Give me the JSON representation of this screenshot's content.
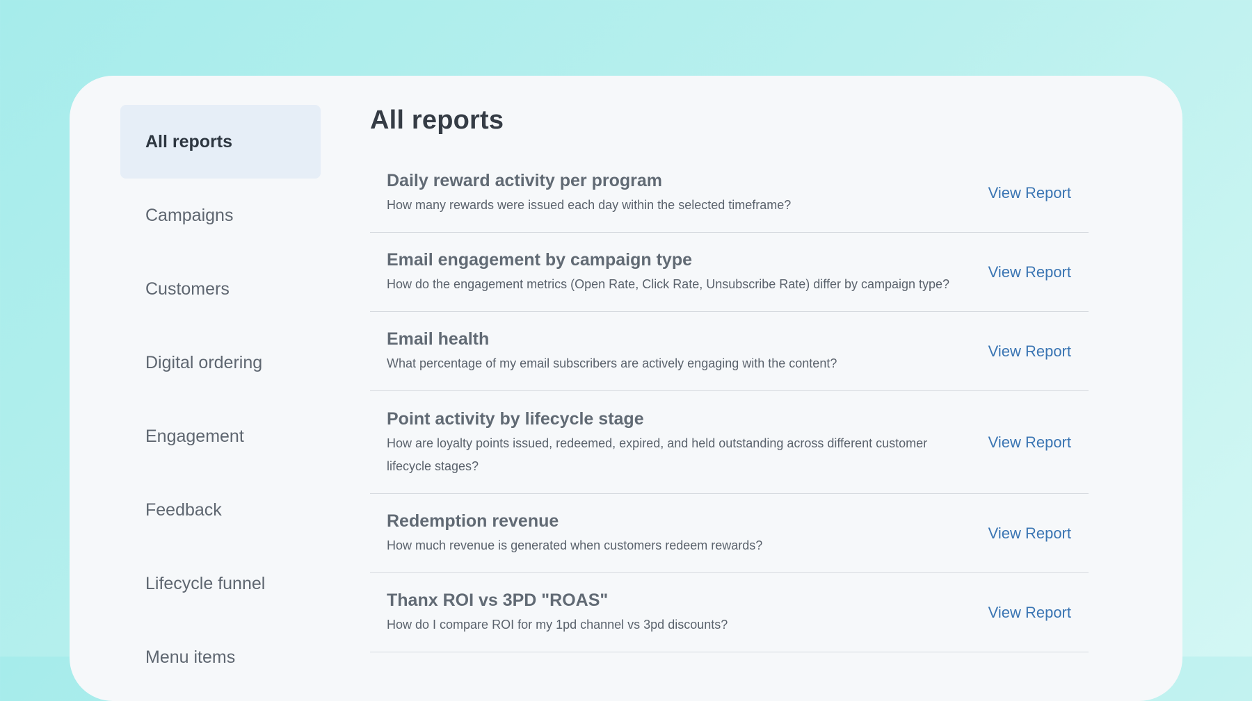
{
  "sidebar": {
    "items": [
      {
        "label": "All reports",
        "active": true
      },
      {
        "label": "Campaigns"
      },
      {
        "label": "Customers"
      },
      {
        "label": "Digital ordering"
      },
      {
        "label": "Engagement"
      },
      {
        "label": "Feedback"
      },
      {
        "label": "Lifecycle funnel"
      },
      {
        "label": "Menu items"
      }
    ]
  },
  "main": {
    "title": "All reports",
    "reports": [
      {
        "title": "Daily reward activity per program",
        "description": "How many rewards were issued each day within the selected timeframe?",
        "link_label": "View Report"
      },
      {
        "title": "Email engagement by campaign type",
        "description": "How do the engagement metrics (Open Rate, Click Rate, Unsubscribe Rate) differ by campaign type?",
        "link_label": "View Report"
      },
      {
        "title": "Email health",
        "description": "What percentage of my email subscribers are actively engaging with the content?",
        "link_label": "View Report"
      },
      {
        "title": "Point activity by lifecycle stage",
        "description": "How are loyalty points issued, redeemed, expired, and held outstanding across different customer lifecycle stages?",
        "link_label": "View Report"
      },
      {
        "title": "Redemption revenue",
        "description": "How much revenue is generated when customers redeem rewards?",
        "link_label": "View Report"
      },
      {
        "title": "Thanx ROI vs 3PD \"ROAS\"",
        "description": "How do I compare ROI for my 1pd channel vs 3pd discounts?",
        "link_label": "View Report"
      }
    ]
  }
}
